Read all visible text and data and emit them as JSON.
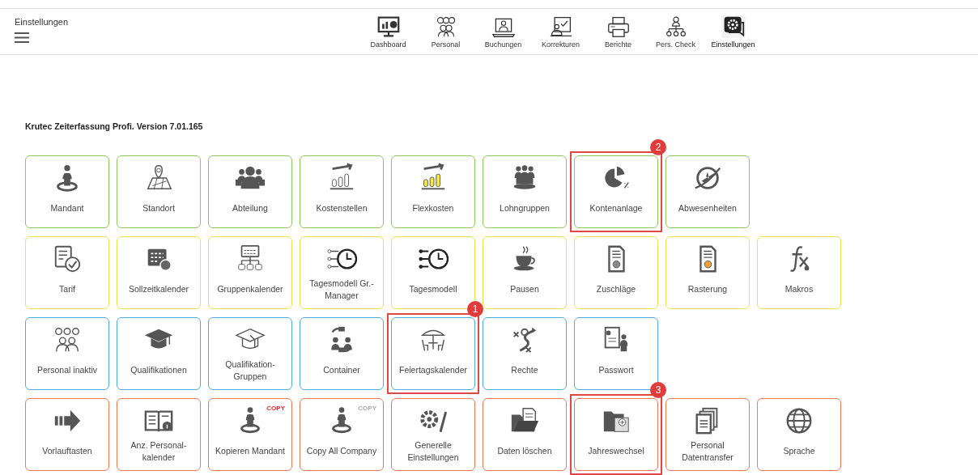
{
  "header": {
    "title": "Einstellungen",
    "nav": [
      {
        "label": "Dashboard",
        "selected": false
      },
      {
        "label": "Personal",
        "selected": false
      },
      {
        "label": "Buchungen",
        "selected": false
      },
      {
        "label": "Korrekturen",
        "selected": false
      },
      {
        "label": "Berichte",
        "selected": false
      },
      {
        "label": "Pers. Check",
        "selected": false
      },
      {
        "label": "Einstellungen",
        "selected": true
      }
    ]
  },
  "version": "Krutec Zeiterfassung Profi. Version 7.01.165",
  "tile_rows": [
    {
      "color": "#8cc85a",
      "tiles": [
        {
          "label": "Mandant"
        },
        {
          "label": "Standort"
        },
        {
          "label": "Abteilung"
        },
        {
          "label": "Kostenstellen"
        },
        {
          "label": "Flexkosten"
        },
        {
          "label": "Lohngruppen"
        },
        {
          "label": "Kontenanlage",
          "marker": "2"
        },
        {
          "label": "Abwesenheiten"
        }
      ]
    },
    {
      "color": "#f0e050",
      "tiles": [
        {
          "label": "Tarif"
        },
        {
          "label": "Sollzeitkalender"
        },
        {
          "label": "Gruppenkalender"
        },
        {
          "label": "Tagesmodell Gr.-Manager"
        },
        {
          "label": "Tagesmodell"
        },
        {
          "label": "Pausen"
        },
        {
          "label": "Zuschläge"
        },
        {
          "label": "Rasterung"
        },
        {
          "label": "Makros"
        }
      ]
    },
    {
      "color": "#4aaee0",
      "tiles": [
        {
          "label": "Personal inaktiv"
        },
        {
          "label": "Qualifikationen"
        },
        {
          "label": "Qualifikation-Gruppen"
        },
        {
          "label": "Container"
        },
        {
          "label": "Feiertagskalender",
          "marker": "1"
        },
        {
          "label": "Rechte"
        },
        {
          "label": "Passwort"
        }
      ]
    },
    {
      "color": "#f07850",
      "tiles": [
        {
          "label": "Vorlauftasten"
        },
        {
          "label": "Anz. Personal-kalender"
        },
        {
          "label": "Kopieren Mandant",
          "badge": {
            "text": "COPY",
            "color": "#e03030"
          }
        },
        {
          "label": "Copy All Company",
          "badge": {
            "text": "COPY",
            "color": "#a8a8a8"
          }
        },
        {
          "label": "Generelle Einstellungen"
        },
        {
          "label": "Daten löschen"
        },
        {
          "label": "Jahreswechsel",
          "marker": "3"
        },
        {
          "label": "Personal Datentransfer"
        },
        {
          "label": "Sprache"
        }
      ]
    }
  ]
}
